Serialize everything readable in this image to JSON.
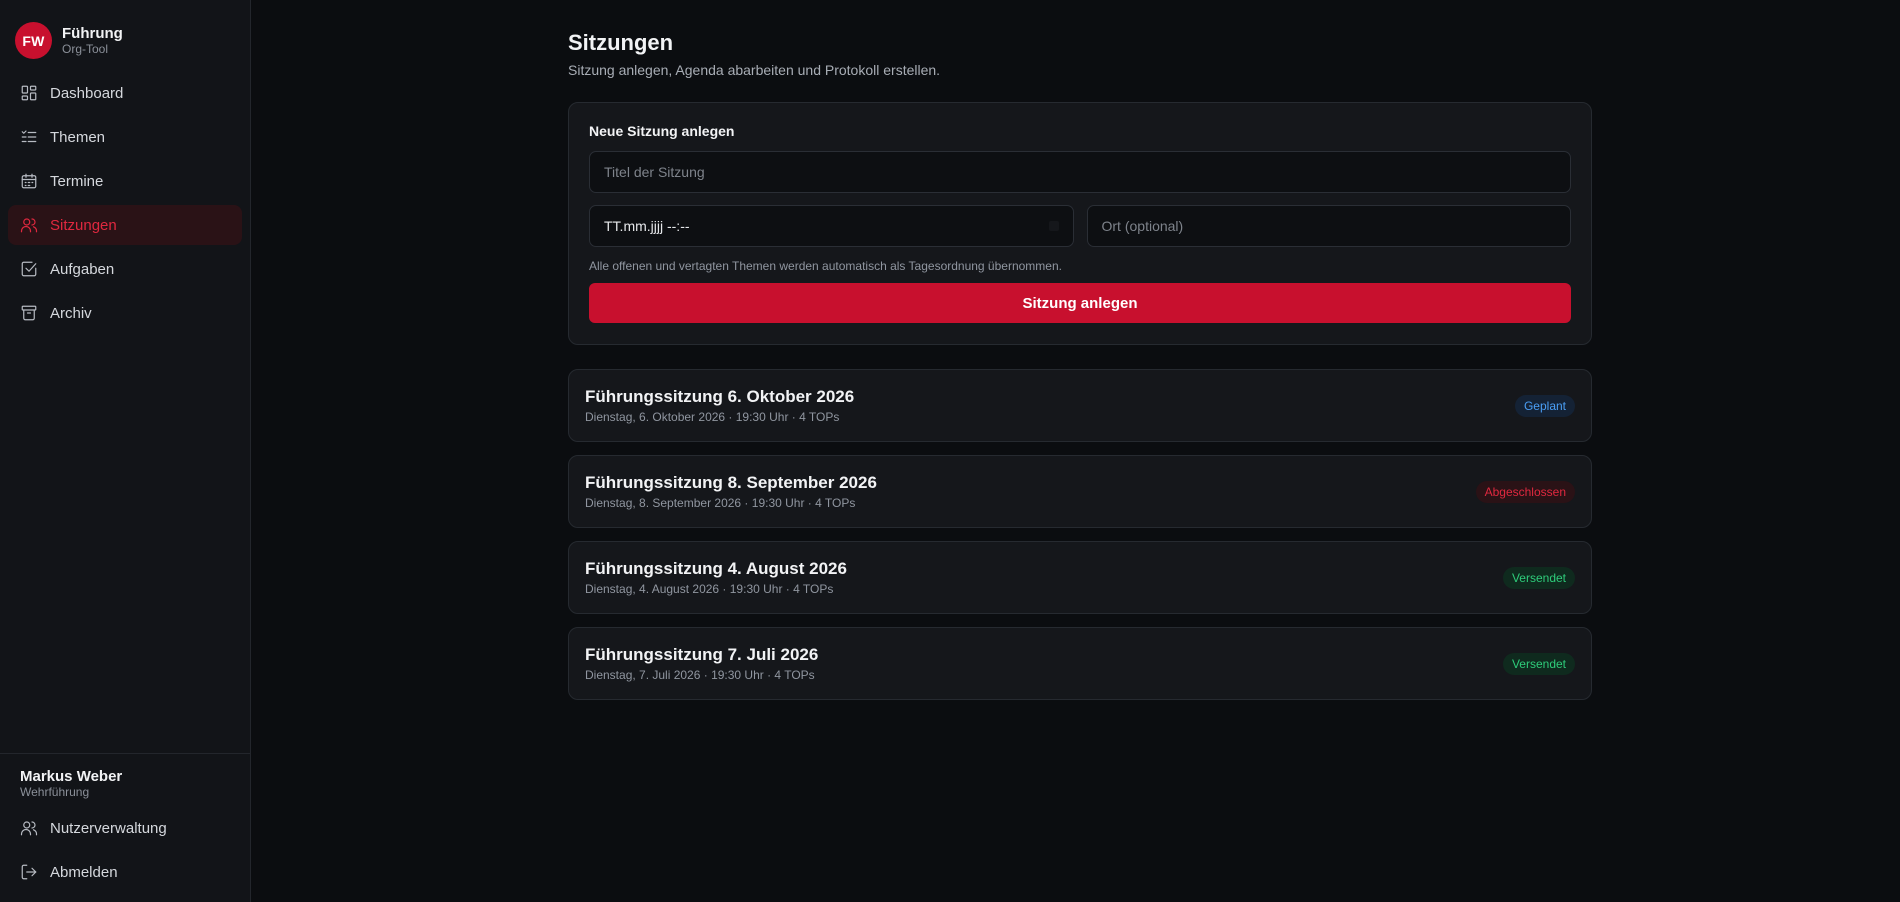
{
  "brand": {
    "logo": "FW",
    "title": "Führung",
    "subtitle": "Org-Tool"
  },
  "sidebar": {
    "items": [
      {
        "label": "Dashboard",
        "icon": "dashboard-icon",
        "active": false
      },
      {
        "label": "Themen",
        "icon": "list-icon",
        "active": false
      },
      {
        "label": "Termine",
        "icon": "calendar-icon",
        "active": false
      },
      {
        "label": "Sitzungen",
        "icon": "users-icon",
        "active": true
      },
      {
        "label": "Aufgaben",
        "icon": "checkbox-icon",
        "active": false
      },
      {
        "label": "Archiv",
        "icon": "archive-icon",
        "active": false
      }
    ],
    "user": {
      "name": "Markus Weber",
      "role": "Wehrführung"
    },
    "bottom_items": [
      {
        "label": "Nutzerverwaltung",
        "icon": "users-icon"
      },
      {
        "label": "Abmelden",
        "icon": "logout-icon"
      }
    ]
  },
  "page": {
    "title": "Sitzungen",
    "subtitle": "Sitzung anlegen, Agenda abarbeiten und Protokoll erstellen."
  },
  "form": {
    "title": "Neue Sitzung anlegen",
    "title_placeholder": "Titel der Sitzung",
    "datetime_placeholder": "TT.mm.jjjj --:--",
    "location_placeholder": "Ort (optional)",
    "hint": "Alle offenen und vertagten Themen werden automatisch als Tagesordnung übernommen.",
    "submit_label": "Sitzung anlegen"
  },
  "sessions": [
    {
      "title": "Führungssitzung 6. Oktober 2026",
      "meta": "Dienstag, 6. Oktober 2026 · 19:30 Uhr · 4 TOPs",
      "status": "Geplant",
      "status_color": "#4a9ef5"
    },
    {
      "title": "Führungssitzung 8. September 2026",
      "meta": "Dienstag, 8. September 2026 · 19:30 Uhr · 4 TOPs",
      "status": "Abgeschlossen",
      "status_color": "#e0283f"
    },
    {
      "title": "Führungssitzung 4. August 2026",
      "meta": "Dienstag, 4. August 2026 · 19:30 Uhr · 4 TOPs",
      "status": "Versendet",
      "status_color": "#2ecc7a"
    },
    {
      "title": "Führungssitzung 7. Juli 2026",
      "meta": "Dienstag, 7. Juli 2026 · 19:30 Uhr · 4 TOPs",
      "status": "Versendet",
      "status_color": "#2ecc7a"
    }
  ],
  "colors": {
    "accent": "#c8102e",
    "background": "#0b0d10",
    "sidebar": "#121418"
  }
}
